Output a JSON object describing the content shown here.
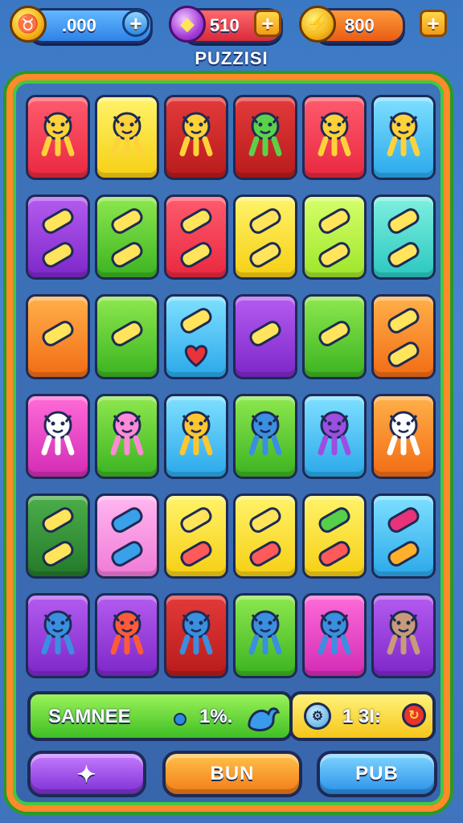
{
  "header": {
    "currency1": {
      "icon": "bull-coin-icon",
      "value": ".000"
    },
    "currency2": {
      "icon": "gem-chest-icon",
      "value": "510"
    },
    "currency3": {
      "icon": "lightning-coin-icon",
      "value": "800"
    },
    "title": "PUZZISI"
  },
  "board": {
    "rows": [
      [
        {
          "color": "red",
          "icons": [
            "star-creature-icon"
          ]
        },
        {
          "color": "yellow",
          "icons": [
            "star-creature-icon"
          ]
        },
        {
          "color": "darkred",
          "icons": [
            "star-creature-icon"
          ]
        },
        {
          "color": "darkred",
          "icons": [
            "green-creature-icon"
          ]
        },
        {
          "color": "red",
          "icons": [
            "star-creature-icon"
          ]
        },
        {
          "color": "cyan",
          "icons": [
            "star-creature-icon"
          ]
        }
      ],
      [
        {
          "color": "purple",
          "icons": [
            "tube-icon",
            "pencil-icon"
          ]
        },
        {
          "color": "green",
          "icons": [
            "radio-icon",
            "crayon-icon"
          ]
        },
        {
          "color": "red",
          "icons": [
            "bone-icon",
            "dumbbell-icon"
          ]
        },
        {
          "color": "yellow",
          "icons": [
            "rolling-pin-icon",
            "eraser-icon"
          ]
        },
        {
          "color": "lime",
          "icons": [
            "tv-icon",
            "marker-icon"
          ]
        },
        {
          "color": "teal",
          "icons": [
            "dinosaur-icon",
            "shoe-icon"
          ]
        }
      ],
      [
        {
          "color": "orange",
          "icons": [
            "flashlight-icon"
          ]
        },
        {
          "color": "green",
          "icons": [
            "lollipop-icon"
          ]
        },
        {
          "color": "cyan",
          "icons": [
            "phone-icon",
            "heart-icon"
          ]
        },
        {
          "color": "purple",
          "icons": [
            "magnifier-icon"
          ]
        },
        {
          "color": "green",
          "icons": [
            "hammer-icon"
          ]
        },
        {
          "color": "orange",
          "icons": [
            "paintbrush-icon",
            "sled-icon"
          ]
        }
      ],
      [
        {
          "color": "magenta",
          "icons": [
            "goat-creature-icon"
          ]
        },
        {
          "color": "green",
          "icons": [
            "pink-creature-icon"
          ]
        },
        {
          "color": "cyan",
          "icons": [
            "yellow-creature-icon"
          ]
        },
        {
          "color": "green",
          "icons": [
            "blue-creature-icon"
          ]
        },
        {
          "color": "cyan",
          "icons": [
            "octopus-icon"
          ]
        },
        {
          "color": "orange",
          "icons": [
            "goat-creature-icon"
          ]
        }
      ],
      [
        {
          "color": "darkgreen",
          "icons": [
            "glove-icon",
            "crayon-icon"
          ]
        },
        {
          "color": "pink",
          "icons": [
            "drop-icon",
            "bear-icon"
          ]
        },
        {
          "color": "yellow",
          "icons": [
            "capsule-icon",
            "fox-icon"
          ]
        },
        {
          "color": "yellow",
          "icons": [
            "bean-icon",
            "fox-icon"
          ]
        },
        {
          "color": "yellow",
          "icons": [
            "frog-icon",
            "fox-icon"
          ]
        },
        {
          "color": "cyan",
          "icons": [
            "briefcase-icon",
            "carrot-icon"
          ]
        }
      ],
      [
        {
          "color": "purple",
          "icons": [
            "robot-icon"
          ]
        },
        {
          "color": "purple",
          "icons": [
            "sun-creature-icon"
          ]
        },
        {
          "color": "darkred",
          "icons": [
            "robot-icon"
          ]
        },
        {
          "color": "green",
          "icons": [
            "robot-icon"
          ]
        },
        {
          "color": "magenta",
          "icons": [
            "robot-icon"
          ]
        },
        {
          "color": "purple",
          "icons": [
            "deer-creature-icon"
          ]
        }
      ]
    ]
  },
  "status": {
    "label": "SAMNEE",
    "percent": "1%.",
    "counter": "1 3I:"
  },
  "buttons": {
    "left_icon": "star-icon",
    "middle": "BUN",
    "right": "PUB"
  }
}
